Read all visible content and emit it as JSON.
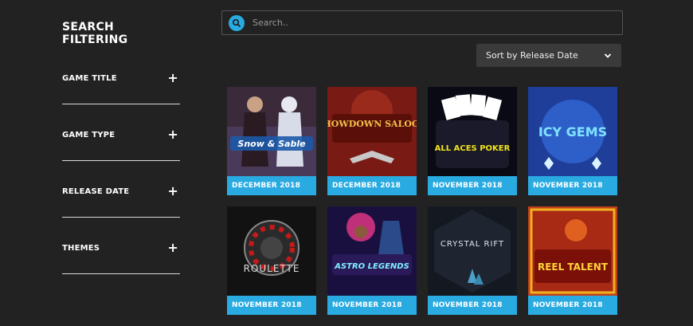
{
  "sidebar": {
    "title": "SEARCH FILTERING",
    "filters": [
      {
        "label": "GAME TITLE"
      },
      {
        "label": "GAME TYPE"
      },
      {
        "label": "RELEASE DATE"
      },
      {
        "label": "THEMES"
      }
    ]
  },
  "search": {
    "placeholder": "Search.."
  },
  "sort": {
    "label": "Sort by Release Date"
  },
  "games": [
    {
      "art_text": "Snow & Sable",
      "date": "DECEMBER 2018"
    },
    {
      "art_text": "SHOWDOWN SALOON",
      "date": "DECEMBER 2018"
    },
    {
      "art_text": "ALL ACES POKER",
      "date": "NOVEMBER 2018"
    },
    {
      "art_text": "ICY GEMS",
      "date": "NOVEMBER 2018"
    },
    {
      "art_text": "ROULETTE",
      "date": "NOVEMBER 2018"
    },
    {
      "art_text": "ASTRO LEGENDS",
      "date": "NOVEMBER 2018"
    },
    {
      "art_text": "CRYSTAL RIFT",
      "date": "NOVEMBER 2018"
    },
    {
      "art_text": "REEL TALENT",
      "date": "NOVEMBER 2018"
    }
  ],
  "colors": {
    "accent": "#29abe2",
    "background": "#222222"
  }
}
